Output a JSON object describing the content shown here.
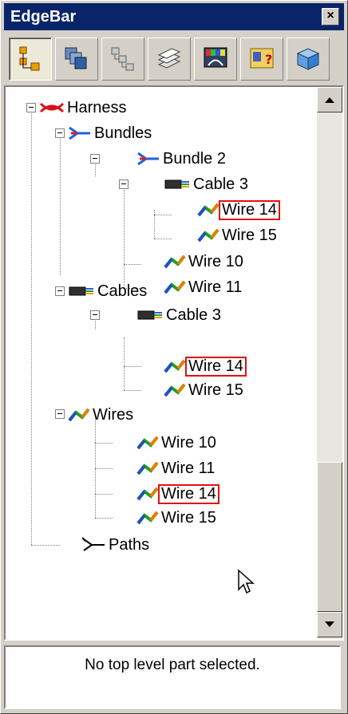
{
  "window": {
    "title": "EdgeBar",
    "close_glyph": "×"
  },
  "tabs": [
    {
      "name": "assembly-tree-tab",
      "icon": "assembly-tree-icon"
    },
    {
      "name": "parts-tab",
      "icon": "parts-library-icon"
    },
    {
      "name": "hierarchy-tab",
      "icon": "hierarchy-icon"
    },
    {
      "name": "layers-tab",
      "icon": "layers-icon"
    },
    {
      "name": "display-tab",
      "icon": "display-config-icon"
    },
    {
      "name": "help-tab",
      "icon": "help-info-icon"
    },
    {
      "name": "view-tab",
      "icon": "view-orient-icon"
    }
  ],
  "tree": {
    "harness": "Harness",
    "bundles": "Bundles",
    "bundle2": "Bundle 2",
    "b_cable3": "Cable 3",
    "b_wire14": "Wire 14",
    "b_wire15": "Wire 15",
    "b_wire10": "Wire 10",
    "b_wire11": "Wire 11",
    "cables": "Cables",
    "c_cable3": "Cable 3",
    "c_wire14": "Wire 14",
    "c_wire15": "Wire 15",
    "wires": "Wires",
    "w_wire10": "Wire 10",
    "w_wire11": "Wire 11",
    "w_wire14": "Wire 14",
    "w_wire15": "Wire 15",
    "paths": "Paths"
  },
  "status": {
    "text": "No top level part selected."
  },
  "colors": {
    "titlebar": "#0a246a",
    "highlight_box": "#e01010",
    "panel": "#d4d0c8"
  }
}
